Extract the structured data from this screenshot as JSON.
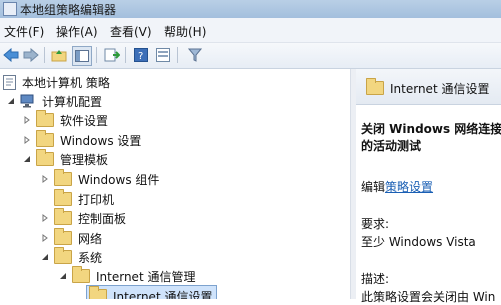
{
  "window": {
    "title": "本地组策略编辑器"
  },
  "menu": [
    "文件(F)",
    "操作(A)",
    "查看(V)",
    "帮助(H)"
  ],
  "toolbar": {
    "icons": [
      "back-arrow-icon",
      "forward-arrow-icon",
      "folder-up-icon",
      "show-hide-tree-icon",
      "export-list-icon",
      "help-icon",
      "properties-icon",
      "filter-icon"
    ]
  },
  "tree": [
    {
      "label": "本地计算机 策略",
      "icon": "policy-doc-icon"
    },
    {
      "label": "计算机配置",
      "icon": "computer-icon"
    },
    {
      "label": "软件设置",
      "icon": "folder-icon"
    },
    {
      "label": "Windows 设置",
      "icon": "folder-icon"
    },
    {
      "label": "管理模板",
      "icon": "folder-icon"
    },
    {
      "label": "Windows 组件",
      "icon": "folder-icon"
    },
    {
      "label": "打印机",
      "icon": "folder-icon"
    },
    {
      "label": "控制面板",
      "icon": "folder-icon"
    },
    {
      "label": "网络",
      "icon": "folder-icon"
    },
    {
      "label": "系统",
      "icon": "folder-icon"
    },
    {
      "label": "Internet 通信管理",
      "icon": "folder-icon"
    },
    {
      "label": "Internet 通信设置",
      "icon": "folder-icon"
    }
  ],
  "right_pane": {
    "header": "Internet 通信设置",
    "policy_title_line1": "关闭 Windows 网络连接",
    "policy_title_line2": "的活动测试",
    "edit_prefix": "编辑",
    "edit_link": "策略设置",
    "requirements_label": "要求:",
    "requirements_value": "至少 Windows Vista",
    "description_label": "描述:",
    "description_start": "此策略设置会关闭由 Win"
  },
  "colors": {
    "accent": "#1a5fb4",
    "selection": "#cfe3fb",
    "titlebar": "#a3bfdd"
  }
}
